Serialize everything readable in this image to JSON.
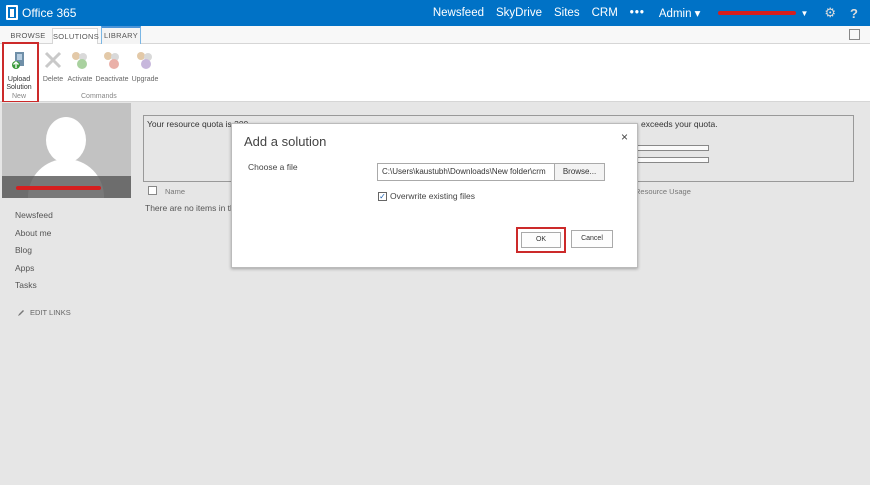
{
  "suitebar": {
    "logo": "Office 365",
    "nav": [
      "Newsfeed",
      "SkyDrive",
      "Sites",
      "CRM"
    ],
    "more": "•••",
    "admin": "Admin ▾",
    "settings_icon": "gear-icon",
    "help_label": "?"
  },
  "ribbon": {
    "tabs": [
      "BROWSE",
      "SOLUTIONS",
      "LIBRARY"
    ],
    "buttons": [
      {
        "label": "Upload Solution",
        "icon": "upload-solution-icon"
      },
      {
        "label": "Delete",
        "icon": "delete-icon"
      },
      {
        "label": "Activate",
        "icon": "activate-icon"
      },
      {
        "label": "Deactivate",
        "icon": "deactivate-icon"
      },
      {
        "label": "Upgrade",
        "icon": "upgrade-icon"
      }
    ],
    "groups": [
      "New",
      "Commands"
    ]
  },
  "leftnav": {
    "items": [
      "Newsfeed",
      "About me",
      "Blog",
      "Apps",
      "Tasks"
    ],
    "edit_links": "EDIT LINKS"
  },
  "main": {
    "quota_text": "Your resource quota is 300",
    "quota_text2": "exceeds your quota.",
    "columns": {
      "name": "Name",
      "usage": "Resource Usage"
    },
    "empty_message": "There are no items in th"
  },
  "dialog": {
    "title": "Add a solution",
    "close": "×",
    "choose_label": "Choose a file",
    "file_path": "C:\\Users\\kaustubh\\Downloads\\New folder\\crm",
    "browse_label": "Browse...",
    "overwrite_label": "Overwrite existing files",
    "overwrite_checked": true,
    "ok_label": "OK",
    "cancel_label": "Cancel"
  },
  "colors": {
    "suitebar": "#0072c6",
    "highlight": "#cc2a2a"
  }
}
